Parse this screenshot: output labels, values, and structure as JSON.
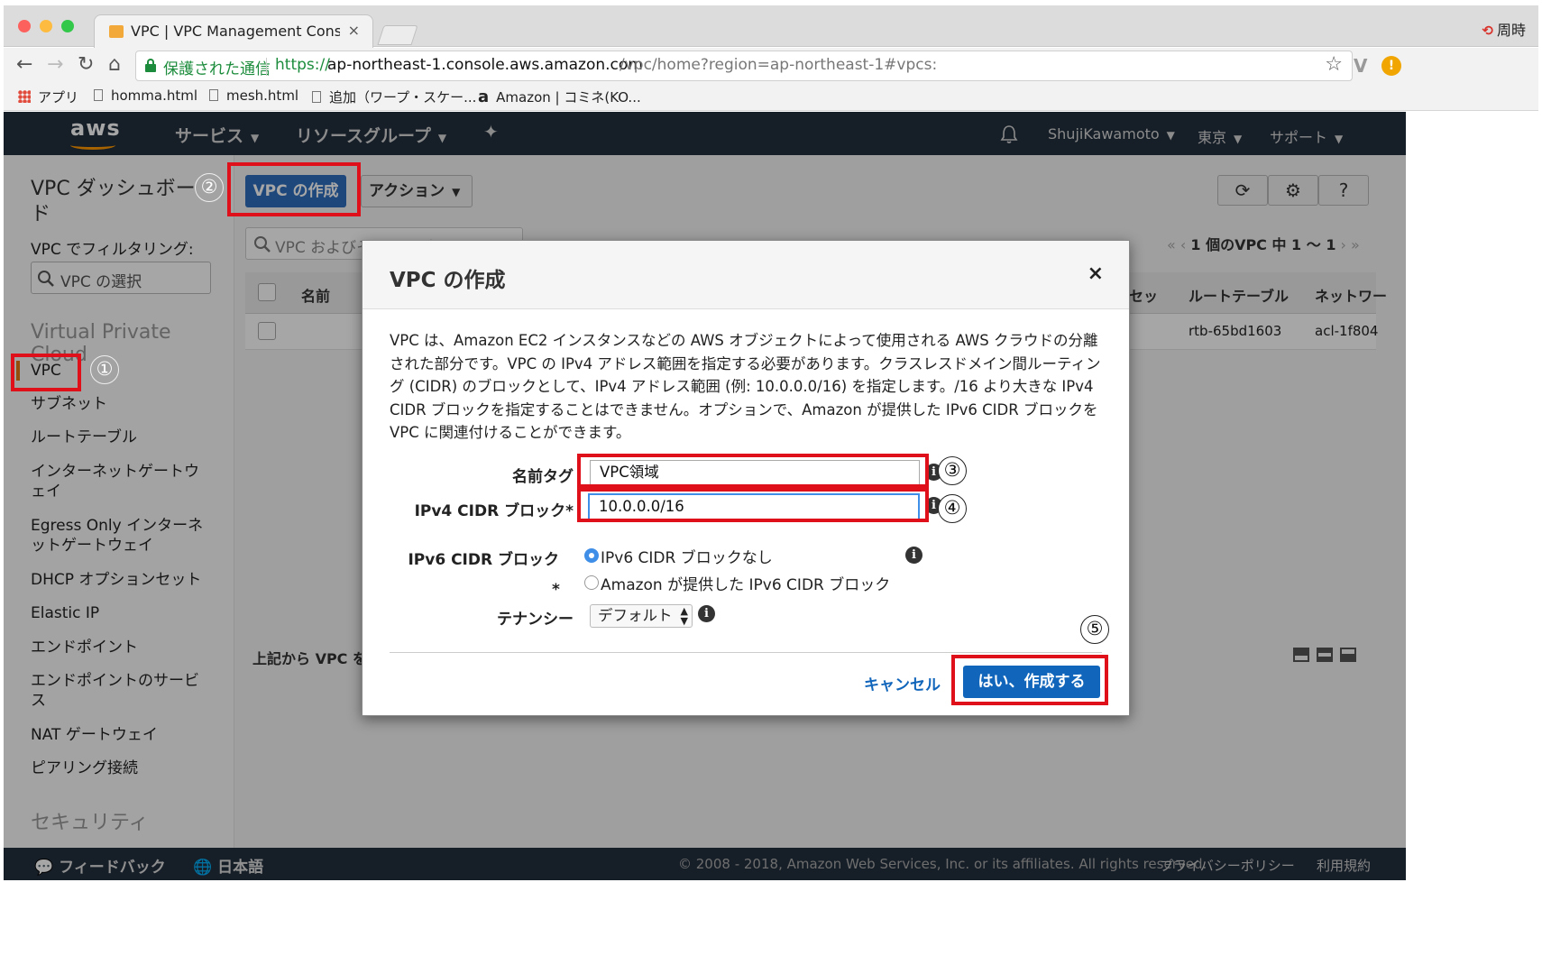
{
  "browser": {
    "tab_title": "VPC | VPC Management Conso",
    "tab_close": "×",
    "profile_label": "周時",
    "secure_label": "保護された通信",
    "url_scheme": "https://",
    "url_host": "ap-northeast-1.console.aws.amazon.com",
    "url_path": "/vpc/home?region=ap-northeast-1#vpcs:",
    "bookmarks": [
      "アプリ",
      "homma.html",
      "mesh.html",
      "追加（ワープ・スケー...",
      "Amazon | コミネ(KO..."
    ]
  },
  "aws_header": {
    "logo": "aws",
    "services": "サービス",
    "resource_groups": "リソースグループ",
    "user": "ShujiKawamoto",
    "region": "東京",
    "support": "サポート"
  },
  "sidebar": {
    "dashboard": "VPC ダッシュボード",
    "filter_label": "VPC でフィルタリング:",
    "filter_placeholder": "VPC の選択",
    "section_vpc": "Virtual Private Cloud",
    "items": [
      "VPC",
      "サブネット",
      "ルートテーブル",
      "インターネットゲートウェイ",
      "Egress Only インターネットゲートウェイ",
      "DHCP オプションセット",
      "Elastic IP",
      "エンドポイント",
      "エンドポイントのサービス",
      "NAT ゲートウェイ",
      "ピアリング接続"
    ],
    "section_security": "セキュリティ"
  },
  "main": {
    "create_vpc": "VPC の作成",
    "actions": "アクション",
    "filter_placeholder": "VPC およびそれらのプロパテ",
    "pager": "1 個のVPC 中 1 〜 1",
    "columns": {
      "name": "名前",
      "dhcp_suffix": "セッ",
      "route_table": "ルートテーブル",
      "network_acl": "ネットワー"
    },
    "row": {
      "route_table": "rtb-65bd1603",
      "network_acl": "acl-1f804"
    },
    "detail_label": "上記から VPC を"
  },
  "footer": {
    "feedback": "フィードバック",
    "language": "日本語",
    "copyright": "© 2008 - 2018, Amazon Web Services, Inc. or its affiliates. All rights reserved.",
    "privacy": "プライバシーポリシー",
    "terms": "利用規約"
  },
  "modal": {
    "title": "VPC の作成",
    "close": "×",
    "description": "VPC は、Amazon EC2 インスタンスなどの AWS オブジェクトによって使用される AWS クラウドの分離された部分です。VPC の IPv4 アドレス範囲を指定する必要があります。クラスレスドメイン間ルーティング (CIDR) のブロックとして、IPv4 アドレス範囲 (例: 10.0.0.0/16) を指定します。/16 より大きな IPv4 CIDR ブロックを指定することはできません。オプションで、Amazon が提供した IPv6 CIDR ブロックを VPC に関連付けることができます。",
    "name_tag_label": "名前タグ",
    "name_tag_value": "VPC領域",
    "ipv4_label": "IPv4 CIDR ブロック*",
    "ipv4_value": "10.0.0.0/16",
    "ipv6_label": "IPv6 CIDR ブロック",
    "ipv6_asterisk": "*",
    "ipv6_option_none": "IPv6 CIDR ブロックなし",
    "ipv6_option_amazon": "Amazon が提供した IPv6 CIDR ブロック",
    "ipv6_selected": "IPv6 CIDR ブロックなし",
    "tenancy_label": "テナンシー",
    "tenancy_value": "デフォルト",
    "cancel": "キャンセル",
    "submit": "はい、作成する"
  },
  "annotations": {
    "steps": [
      "①",
      "②",
      "③",
      "④",
      "⑤"
    ],
    "highlight_color": "#e0101a"
  },
  "colors": {
    "aws_nav": "#232f3e",
    "primary_button": "#1166bb",
    "secure_green": "#1c8c3c"
  }
}
